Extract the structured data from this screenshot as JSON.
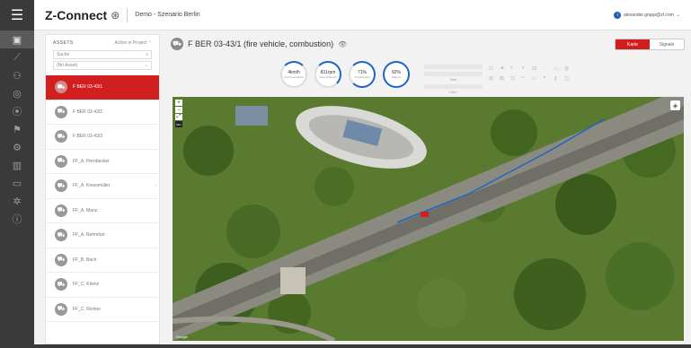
{
  "app": {
    "brand": "Z-Connect",
    "scenario": "Demo - Szenario Berlin",
    "user_email": "alexander.grupp@zf.com"
  },
  "assets": {
    "title": "ASSETS",
    "sort_label": "Active in Project",
    "search_placeholder": "Suche",
    "filter_value": "(No Asset)",
    "items": [
      {
        "label": "F BER 03-43/1",
        "selected": true
      },
      {
        "label": "F BER 03-43/2",
        "selected": false
      },
      {
        "label": "F BER 03-43/3",
        "selected": false
      },
      {
        "label": "FF_A. Hornbecker",
        "selected": false
      },
      {
        "label": "FF_A. Kressmüller",
        "selected": false
      },
      {
        "label": "FF_A. Manz",
        "selected": false
      },
      {
        "label": "FF_A. Rehmfurt",
        "selected": false
      },
      {
        "label": "FF_B. Bach",
        "selected": false
      },
      {
        "label": "FF_C. Klemz",
        "selected": false
      },
      {
        "label": "FF_C. Richter",
        "selected": false
      }
    ]
  },
  "vehicle": {
    "title": "F BER 03-43/1 (fire vehicle, combustion)"
  },
  "view_toggle": {
    "map_label": "Karte",
    "signals_label": "Signale"
  },
  "gauges": [
    {
      "value": "4km/h",
      "label": "Geschwindigkeit"
    },
    {
      "value": "831rpm",
      "label": "Motordrehzahl"
    },
    {
      "value": "71%",
      "label": "Tankfüllstand"
    },
    {
      "value": "92%",
      "label": "Batterie"
    }
  ],
  "status_bars": {
    "label_1": "Wert",
    "label_2": "Fahrt"
  },
  "map": {
    "zoom_in": "+",
    "zoom_out": "−",
    "fullscreen": "⤢",
    "scale_label": "50m",
    "attribution": "Google",
    "vehicle_marker": "F"
  },
  "colors": {
    "accent": "#d11f1f",
    "sidebar": "#3a3a3a",
    "track": "#1e64c8"
  }
}
